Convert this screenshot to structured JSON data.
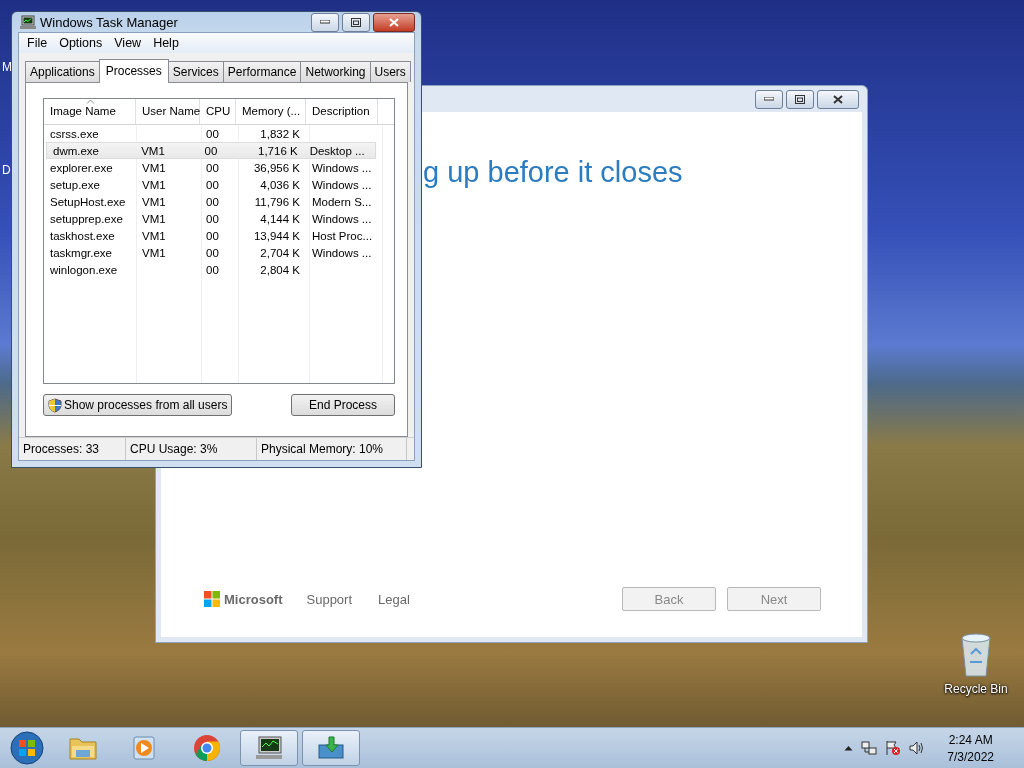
{
  "desktop_edge_labels": [
    "M",
    "D"
  ],
  "setup_window": {
    "heading": "g up before it closes",
    "brand": "Microsoft",
    "links": [
      "Support",
      "Legal"
    ],
    "buttons": [
      {
        "label": "Back",
        "disabled": true
      },
      {
        "label": "Next",
        "disabled": true
      }
    ]
  },
  "task_manager": {
    "title": "Windows Task Manager",
    "menu": [
      "File",
      "Options",
      "View",
      "Help"
    ],
    "tabs": [
      {
        "label": "Applications",
        "selected": false
      },
      {
        "label": "Processes",
        "selected": true
      },
      {
        "label": "Services",
        "selected": false
      },
      {
        "label": "Performance",
        "selected": false
      },
      {
        "label": "Networking",
        "selected": false
      },
      {
        "label": "Users",
        "selected": false
      }
    ],
    "columns": [
      {
        "label": "Image Name",
        "sorted": true
      },
      {
        "label": "User Name",
        "sorted": false
      },
      {
        "label": "CPU",
        "sorted": false
      },
      {
        "label": "Memory (...",
        "sorted": false
      },
      {
        "label": "Description",
        "sorted": false
      }
    ],
    "rows": [
      {
        "image_name": "csrss.exe",
        "user_name": "",
        "cpu": "00",
        "memory": "1,832 K",
        "description": "",
        "selected": false
      },
      {
        "image_name": "dwm.exe",
        "user_name": "VM1",
        "cpu": "00",
        "memory": "1,716 K",
        "description": "Desktop ...",
        "selected": true
      },
      {
        "image_name": "explorer.exe",
        "user_name": "VM1",
        "cpu": "00",
        "memory": "36,956 K",
        "description": "Windows ...",
        "selected": false
      },
      {
        "image_name": "setup.exe",
        "user_name": "VM1",
        "cpu": "00",
        "memory": "4,036 K",
        "description": "Windows ...",
        "selected": false
      },
      {
        "image_name": "SetupHost.exe",
        "user_name": "VM1",
        "cpu": "00",
        "memory": "11,796 K",
        "description": "Modern S...",
        "selected": false
      },
      {
        "image_name": "setupprep.exe",
        "user_name": "VM1",
        "cpu": "00",
        "memory": "4,144 K",
        "description": "Windows ...",
        "selected": false
      },
      {
        "image_name": "taskhost.exe",
        "user_name": "VM1",
        "cpu": "00",
        "memory": "13,944 K",
        "description": "Host Proc...",
        "selected": false
      },
      {
        "image_name": "taskmgr.exe",
        "user_name": "VM1",
        "cpu": "00",
        "memory": "2,704 K",
        "description": "Windows ...",
        "selected": false
      },
      {
        "image_name": "winlogon.exe",
        "user_name": "",
        "cpu": "00",
        "memory": "2,804 K",
        "description": "",
        "selected": false
      }
    ],
    "buttons": [
      {
        "label": "Show processes from all users",
        "kind": "shield"
      },
      {
        "label": "End Process",
        "kind": "plain"
      }
    ],
    "status_bar": [
      "Processes: 33",
      "CPU Usage: 3%",
      "Physical Memory: 10%"
    ]
  },
  "recycle_bin": {
    "label": "Recycle Bin"
  },
  "taskbar": {
    "apps": [
      {
        "kind": "folder",
        "active": false
      },
      {
        "kind": "media",
        "active": false
      },
      {
        "kind": "chrome",
        "active": false
      },
      {
        "kind": "monitor",
        "active": true
      },
      {
        "kind": "installer",
        "active": true
      }
    ],
    "time": "2:24 AM",
    "date": "7/3/2022"
  }
}
